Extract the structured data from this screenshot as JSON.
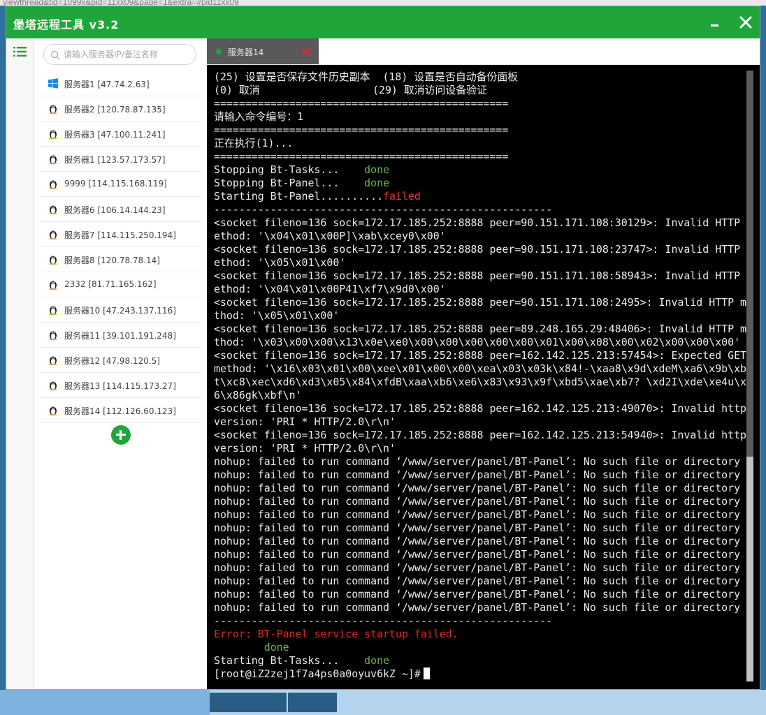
{
  "background_url_text": "viewthread&tid=1099x&pid=11xx09&page=1&extra=#pid11xx09",
  "app": {
    "title": "堡塔远程工具 v3.2",
    "minimize_icon": "minimize-icon",
    "close_icon": "close-icon",
    "accent_color": "#20a53a"
  },
  "rail": {
    "icon": "list-icon"
  },
  "search": {
    "placeholder": "请输入服务器IP/备注名称",
    "value": ""
  },
  "servers": [
    {
      "os": "windows",
      "label": "服务器1 [47.74.2.63]"
    },
    {
      "os": "linux",
      "label": "服务器2 [120.78.87.135]"
    },
    {
      "os": "linux",
      "label": "服务器3 [47.100.11.241]"
    },
    {
      "os": "linux",
      "label": "服务器1 [123.57.173.57]"
    },
    {
      "os": "linux",
      "label": "9999 [114.115.168.119]"
    },
    {
      "os": "linux",
      "label": "服务器6 [106.14.144.23]"
    },
    {
      "os": "linux",
      "label": "服务器7 [114.115.250.194]"
    },
    {
      "os": "linux",
      "label": "服务器8 [120.78.78.14]"
    },
    {
      "os": "linux",
      "label": "2332 [81.71.165.162]"
    },
    {
      "os": "linux",
      "label": "服务器10 [47.243.137.116]"
    },
    {
      "os": "linux",
      "label": "服务器11 [39.101.191.248]"
    },
    {
      "os": "linux",
      "label": "服务器12 [47.98.120.5]"
    },
    {
      "os": "linux",
      "label": "服务器13 [114.115.173.27]"
    },
    {
      "os": "linux",
      "label": "服务器14 [112.126.60.123]"
    }
  ],
  "add_button": {
    "icon": "plus-icon"
  },
  "tab": {
    "label": "服务器14",
    "status": "connected",
    "close_icon": "close-icon"
  },
  "terminal": {
    "lines": [
      {
        "segments": [
          {
            "text": "(25) 设置是否保存文件历史副本  (18) 设置是否自动备份面板"
          }
        ]
      },
      {
        "segments": [
          {
            "text": "(0) 取消                  (29) 取消访问设备验证"
          }
        ]
      },
      {
        "segments": [
          {
            "text": "==============================================="
          }
        ]
      },
      {
        "segments": [
          {
            "text": "请输入命令编号：1"
          }
        ]
      },
      {
        "segments": [
          {
            "text": "==============================================="
          }
        ]
      },
      {
        "segments": [
          {
            "text": "正在执行(1)..."
          }
        ]
      },
      {
        "segments": [
          {
            "text": "==============================================="
          }
        ]
      },
      {
        "segments": [
          {
            "text": "Stopping Bt-Tasks...    "
          },
          {
            "text": "done",
            "style": "ok"
          }
        ]
      },
      {
        "segments": [
          {
            "text": "Stopping Bt-Panel...    "
          },
          {
            "text": "done",
            "style": "ok"
          }
        ]
      },
      {
        "segments": [
          {
            "text": "Starting Bt-Panel.........."
          },
          {
            "text": "failed",
            "style": "bad"
          }
        ]
      },
      {
        "segments": [
          {
            "text": "------------------------------------------------------"
          }
        ]
      },
      {
        "segments": [
          {
            "text": "<socket fileno=136 sock=172.17.185.252:8888 peer=90.151.171.108:30129>: Invalid HTTP m"
          }
        ]
      },
      {
        "segments": [
          {
            "text": "ethod: '\\x04\\x01\\x00P]\\xab\\xcey0\\x00'"
          }
        ]
      },
      {
        "segments": [
          {
            "text": "<socket fileno=136 sock=172.17.185.252:8888 peer=90.151.171.108:23747>: Invalid HTTP m"
          }
        ]
      },
      {
        "segments": [
          {
            "text": "ethod: '\\x05\\x01\\x00'"
          }
        ]
      },
      {
        "segments": [
          {
            "text": "<socket fileno=136 sock=172.17.185.252:8888 peer=90.151.171.108:58943>: Invalid HTTP m"
          }
        ]
      },
      {
        "segments": [
          {
            "text": "ethod: '\\x04\\x01\\x00P41\\xf7\\x9d0\\x00'"
          }
        ]
      },
      {
        "segments": [
          {
            "text": "<socket fileno=136 sock=172.17.185.252:8888 peer=90.151.171.108:2495>: Invalid HTTP me"
          }
        ]
      },
      {
        "segments": [
          {
            "text": "thod: '\\x05\\x01\\x00'"
          }
        ]
      },
      {
        "segments": [
          {
            "text": "<socket fileno=136 sock=172.17.185.252:8888 peer=89.248.165.29:48406>: Invalid HTTP me"
          }
        ]
      },
      {
        "segments": [
          {
            "text": "thod: '\\x03\\x00\\x00\\x13\\x0e\\xe0\\x00\\x00\\x00\\x00\\x00\\x01\\x00\\x08\\x00\\x02\\x00\\x00\\x00'"
          }
        ]
      },
      {
        "segments": [
          {
            "text": "<socket fileno=136 sock=172.17.185.252:8888 peer=162.142.125.213:57454>: Expected GET"
          }
        ]
      },
      {
        "segments": [
          {
            "text": "method: '\\x16\\x03\\x01\\x00\\xee\\x01\\x00\\x00\\xea\\x03\\x03k\\x84!-\\xaa8\\x9d\\xdeM\\xa6\\x9b\\xb5"
          }
        ]
      },
      {
        "segments": [
          {
            "text": "t\\xc8\\xec\\xd6\\xd3\\x05\\x84\\xfdB\\xaa\\xb6\\xe6\\x83\\x93\\x9f\\xbd5\\xae\\xb7? \\xd2I\\xde\\xe4u\\x9"
          }
        ]
      },
      {
        "segments": [
          {
            "text": "6\\x86gk\\xbf\\n'"
          }
        ]
      },
      {
        "segments": [
          {
            "text": "<socket fileno=136 sock=172.17.185.252:8888 peer=162.142.125.213:49070>: Invalid http"
          }
        ]
      },
      {
        "segments": [
          {
            "text": "version: 'PRI * HTTP/2.0\\r\\n'"
          }
        ]
      },
      {
        "segments": [
          {
            "text": "<socket fileno=136 sock=172.17.185.252:8888 peer=162.142.125.213:54940>: Invalid http"
          }
        ]
      },
      {
        "segments": [
          {
            "text": "version: 'PRI * HTTP/2.0\\r\\n'"
          }
        ]
      },
      {
        "segments": [
          {
            "text": "nohup: failed to run command ‘/www/server/panel/BT-Panel’: No such file or directory"
          }
        ]
      },
      {
        "segments": [
          {
            "text": "nohup: failed to run command ‘/www/server/panel/BT-Panel’: No such file or directory"
          }
        ]
      },
      {
        "segments": [
          {
            "text": "nohup: failed to run command ‘/www/server/panel/BT-Panel’: No such file or directory"
          }
        ]
      },
      {
        "segments": [
          {
            "text": "nohup: failed to run command ‘/www/server/panel/BT-Panel’: No such file or directory"
          }
        ]
      },
      {
        "segments": [
          {
            "text": "nohup: failed to run command ‘/www/server/panel/BT-Panel’: No such file or directory"
          }
        ]
      },
      {
        "segments": [
          {
            "text": "nohup: failed to run command ‘/www/server/panel/BT-Panel’: No such file or directory"
          }
        ]
      },
      {
        "segments": [
          {
            "text": "nohup: failed to run command ‘/www/server/panel/BT-Panel’: No such file or directory"
          }
        ]
      },
      {
        "segments": [
          {
            "text": "nohup: failed to run command ‘/www/server/panel/BT-Panel’: No such file or directory"
          }
        ]
      },
      {
        "segments": [
          {
            "text": "nohup: failed to run command ‘/www/server/panel/BT-Panel’: No such file or directory"
          }
        ]
      },
      {
        "segments": [
          {
            "text": "nohup: failed to run command ‘/www/server/panel/BT-Panel’: No such file or directory"
          }
        ]
      },
      {
        "segments": [
          {
            "text": "nohup: failed to run command ‘/www/server/panel/BT-Panel’: No such file or directory"
          }
        ]
      },
      {
        "segments": [
          {
            "text": "nohup: failed to run command ‘/www/server/panel/BT-Panel’: No such file or directory"
          }
        ]
      },
      {
        "segments": [
          {
            "text": "------------------------------------------------------"
          }
        ]
      },
      {
        "segments": [
          {
            "text": "Error: BT-Panel service startup failed.",
            "style": "err"
          }
        ]
      },
      {
        "segments": [
          {
            "text": "        "
          },
          {
            "text": "done",
            "style": "ok"
          }
        ]
      },
      {
        "segments": [
          {
            "text": "Starting Bt-Tasks...    "
          },
          {
            "text": "done",
            "style": "ok"
          }
        ]
      },
      {
        "segments": [
          {
            "text": "[root@iZ2zej1f7a4ps0a0oyuv6kZ ~]#"
          }
        ],
        "cursor": true
      }
    ],
    "colors": {
      "text": "#ececec",
      "ok": "#6eb54a",
      "failed": "#e03b2f",
      "error": "#d52a25",
      "background": "#000000"
    },
    "scroll_position": 0.63
  }
}
